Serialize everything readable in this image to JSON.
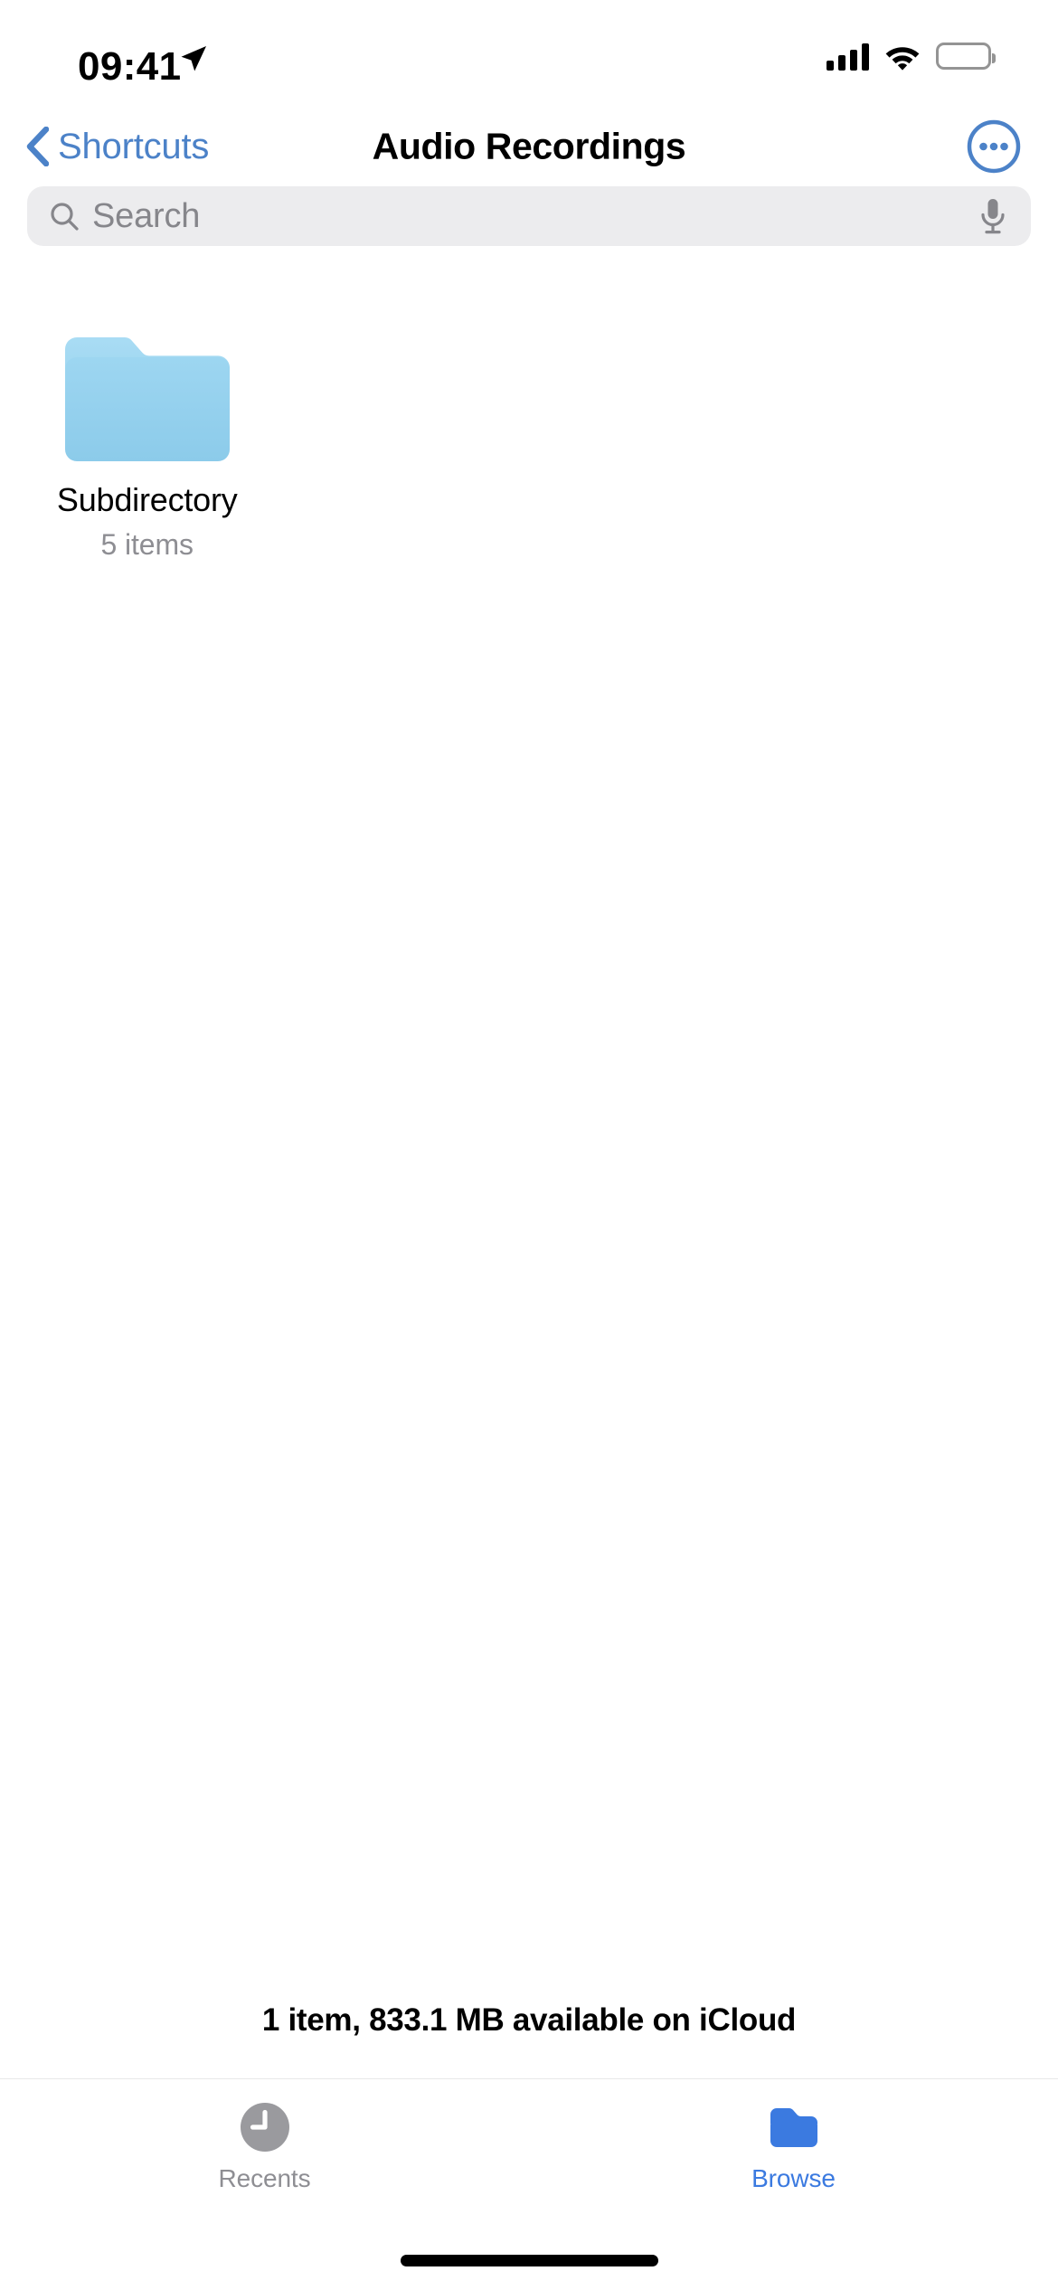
{
  "status_bar": {
    "time": "09:41",
    "location_icon": "location-arrow-icon",
    "cellular_icon": "cellular-bars-icon",
    "wifi_icon": "wifi-icon",
    "battery_icon": "battery-full-icon"
  },
  "nav_bar": {
    "back_label": "Shortcuts",
    "back_icon": "chevron-left-icon",
    "title": "Audio Recordings",
    "more_icon": "ellipsis-circle-icon"
  },
  "search": {
    "placeholder": "Search",
    "value": "",
    "search_icon": "magnifying-glass-icon",
    "dictation_icon": "microphone-icon"
  },
  "items": [
    {
      "name": "Subdirectory",
      "subtitle": "5 items",
      "icon": "folder-icon",
      "icon_color": "#9BD3F0"
    }
  ],
  "footer": {
    "status_text": "1 item, 833.1 MB available on iCloud"
  },
  "tab_bar": {
    "tabs": [
      {
        "label": "Recents",
        "icon": "clock-icon",
        "active": false
      },
      {
        "label": "Browse",
        "icon": "folder-icon",
        "active": true
      }
    ]
  },
  "colors": {
    "accent": "#3b7ae0",
    "tint_blue": "#4c82c8",
    "folder_light": "#9BD3F0",
    "folder_blue": "#3b7ae0",
    "secondary_text": "#8e8e93",
    "search_background": "#ececee"
  },
  "home_indicator": {
    "visible": true
  }
}
